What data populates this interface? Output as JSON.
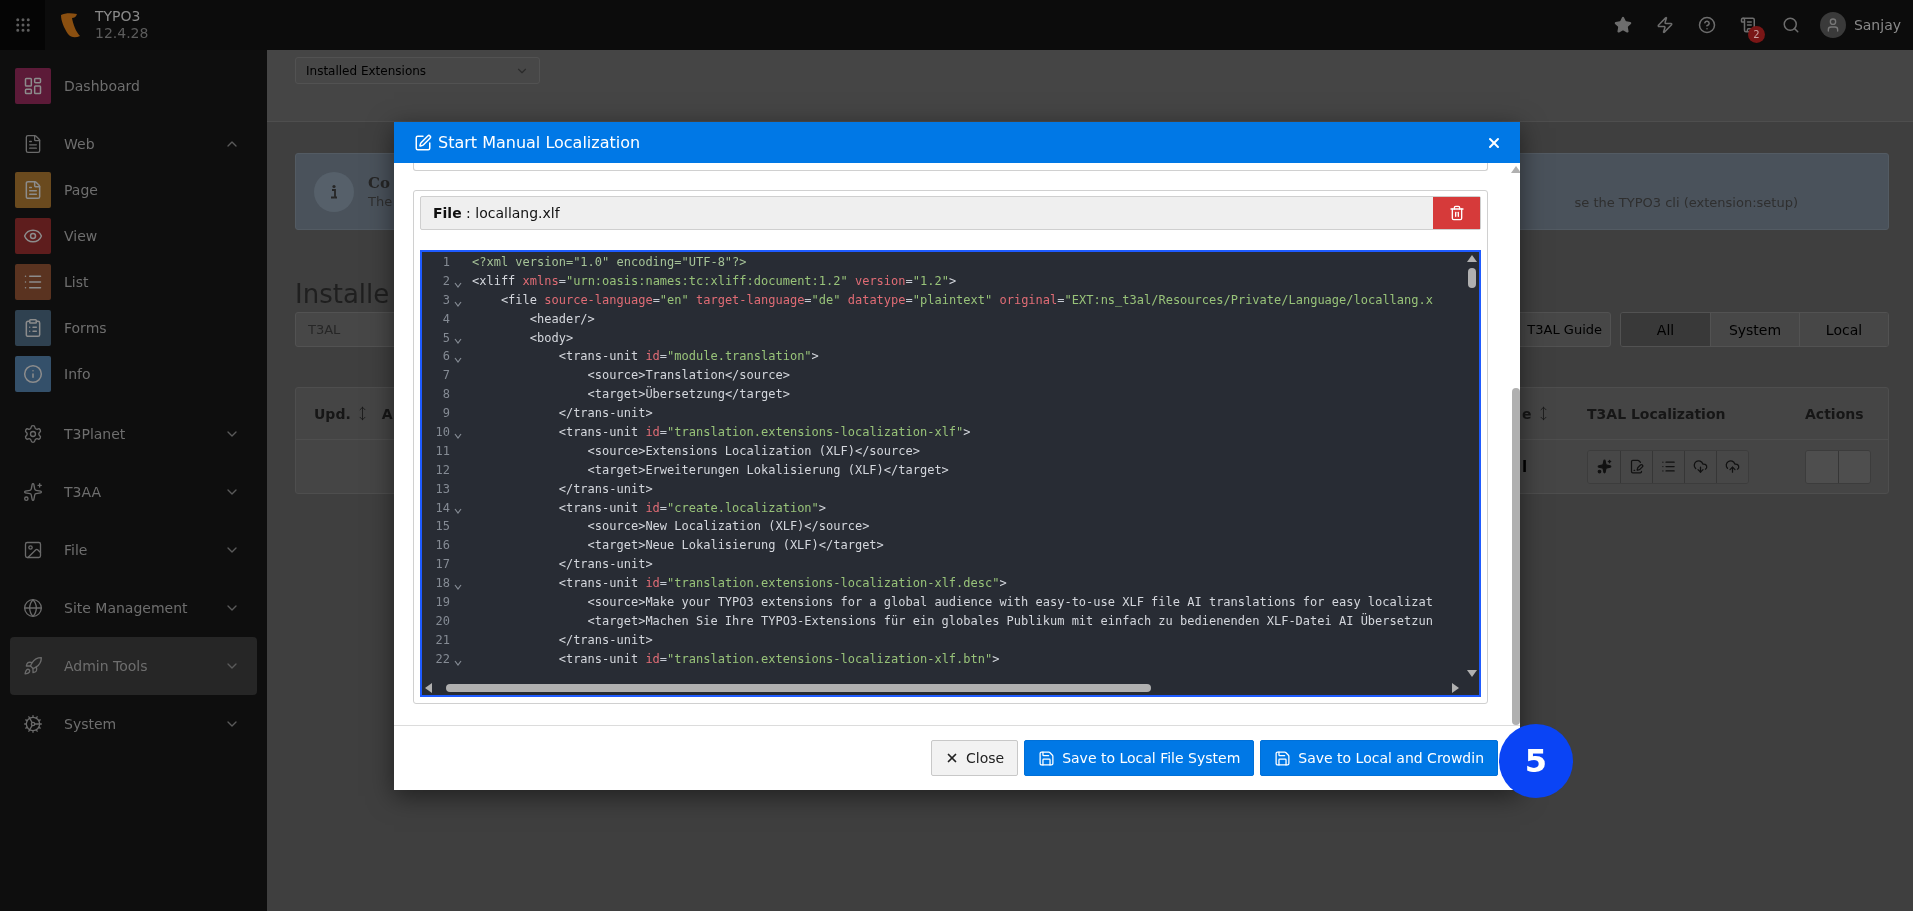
{
  "topbar": {
    "brand": "TYPO3",
    "version": "12.4.28",
    "notification_count": "2",
    "user": "Sanjay"
  },
  "sidebar": {
    "items": [
      {
        "label": "Dashboard",
        "kind": "module",
        "color": "#5c1a38",
        "selected": false
      },
      {
        "label": "Web",
        "kind": "group",
        "expanded": true,
        "selected": false,
        "children": [
          {
            "label": "Page",
            "color": "#6a4a1e",
            "selected": false
          },
          {
            "label": "View",
            "color": "#5e1d1d",
            "selected": false
          },
          {
            "label": "List",
            "color": "#5a3320",
            "selected": false
          },
          {
            "label": "Forms",
            "color": "#2f4150",
            "selected": false
          },
          {
            "label": "Info",
            "color": "#34506a",
            "selected": false
          }
        ]
      },
      {
        "label": "T3Planet",
        "kind": "group",
        "expanded": false,
        "selected": false
      },
      {
        "label": "T3AA",
        "kind": "group",
        "expanded": false,
        "selected": false
      },
      {
        "label": "File",
        "kind": "group",
        "expanded": false,
        "selected": false
      },
      {
        "label": "Site Management",
        "kind": "group",
        "expanded": false,
        "selected": false
      },
      {
        "label": "Admin Tools",
        "kind": "group",
        "expanded": false,
        "selected": true
      },
      {
        "label": "System",
        "kind": "group",
        "expanded": false,
        "selected": false
      }
    ]
  },
  "module_header": {
    "view_select": "Installed Extensions"
  },
  "callout": {
    "title": "Co",
    "text_left": "The",
    "text_right": "se the TYPO3 cli (extension:setup)"
  },
  "heading": "Installe",
  "filter": {
    "search_value": "T3AL",
    "guide_button": "T3AL Guide",
    "views": [
      {
        "label": "All",
        "selected": true
      },
      {
        "label": "System",
        "selected": false
      },
      {
        "label": "Local",
        "selected": false
      }
    ]
  },
  "table": {
    "columns_left": [
      {
        "label": "Upd.",
        "sortable": true
      },
      {
        "label": "A",
        "sortable": false
      }
    ],
    "columns_right": [
      {
        "label": "e",
        "sortable": true
      },
      {
        "label": "T3AL Localization",
        "sortable": false
      },
      {
        "label": "Actions",
        "sortable": false
      }
    ],
    "rows": [
      {
        "cell_fragment": "l"
      }
    ]
  },
  "modal": {
    "title": "Start Manual Localization",
    "file_label": "**File** : locallang.xlf",
    "editor": {
      "lines": [
        {
          "number": "1",
          "fold": false,
          "tokens": [
            {
              "kind": "meta",
              "text": "<?xml version=\"1.0\" encoding=\"UTF-8\"?>"
            }
          ]
        },
        {
          "number": "2",
          "fold": true,
          "tokens": [
            {
              "kind": "tag",
              "text": "<xliff"
            },
            {
              "kind": "attr",
              "text": " xmlns"
            },
            {
              "kind": "punct",
              "text": "="
            },
            {
              "kind": "string",
              "text": "\"urn:oasis:names:tc:xliff:document:1.2\""
            },
            {
              "kind": "attr",
              "text": " version"
            },
            {
              "kind": "punct",
              "text": "="
            },
            {
              "kind": "string",
              "text": "\"1.2\""
            },
            {
              "kind": "tag",
              "text": ">"
            }
          ]
        },
        {
          "number": "3",
          "fold": true,
          "tokens": [
            {
              "kind": "tag",
              "text": "    <file"
            },
            {
              "kind": "attr",
              "text": " source-language"
            },
            {
              "kind": "punct",
              "text": "="
            },
            {
              "kind": "string",
              "text": "\"en\""
            },
            {
              "kind": "attr",
              "text": " target-language"
            },
            {
              "kind": "punct",
              "text": "="
            },
            {
              "kind": "string",
              "text": "\"de\""
            },
            {
              "kind": "attr",
              "text": " datatype"
            },
            {
              "kind": "punct",
              "text": "="
            },
            {
              "kind": "string",
              "text": "\"plaintext\""
            },
            {
              "kind": "attr",
              "text": " original"
            },
            {
              "kind": "punct",
              "text": "="
            },
            {
              "kind": "string",
              "text": "\"EXT:ns_t3al/Resources/Private/Language/locallang.x"
            }
          ]
        },
        {
          "number": "4",
          "fold": false,
          "tokens": [
            {
              "kind": "tag",
              "text": "        <header/>"
            }
          ]
        },
        {
          "number": "5",
          "fold": true,
          "tokens": [
            {
              "kind": "tag",
              "text": "        <body>"
            }
          ]
        },
        {
          "number": "6",
          "fold": true,
          "tokens": [
            {
              "kind": "tag",
              "text": "            <trans-unit"
            },
            {
              "kind": "attr",
              "text": " id"
            },
            {
              "kind": "punct",
              "text": "="
            },
            {
              "kind": "string",
              "text": "\"module.translation\""
            },
            {
              "kind": "tag",
              "text": ">"
            }
          ]
        },
        {
          "number": "7",
          "fold": false,
          "tokens": [
            {
              "kind": "tag",
              "text": "                <source>"
            },
            {
              "kind": "text",
              "text": "Translation"
            },
            {
              "kind": "tag",
              "text": "</source>"
            }
          ]
        },
        {
          "number": "8",
          "fold": false,
          "tokens": [
            {
              "kind": "tag",
              "text": "                <target>"
            },
            {
              "kind": "text",
              "text": "Übersetzung"
            },
            {
              "kind": "tag",
              "text": "</target>"
            }
          ]
        },
        {
          "number": "9",
          "fold": false,
          "tokens": [
            {
              "kind": "tag",
              "text": "            </trans-unit>"
            }
          ]
        },
        {
          "number": "10",
          "fold": true,
          "tokens": [
            {
              "kind": "tag",
              "text": "            <trans-unit"
            },
            {
              "kind": "attr",
              "text": " id"
            },
            {
              "kind": "punct",
              "text": "="
            },
            {
              "kind": "string",
              "text": "\"translation.extensions-localization-xlf\""
            },
            {
              "kind": "tag",
              "text": ">"
            }
          ]
        },
        {
          "number": "11",
          "fold": false,
          "tokens": [
            {
              "kind": "tag",
              "text": "                <source>"
            },
            {
              "kind": "text",
              "text": "Extensions Localization (XLF)"
            },
            {
              "kind": "tag",
              "text": "</source>"
            }
          ]
        },
        {
          "number": "12",
          "fold": false,
          "tokens": [
            {
              "kind": "tag",
              "text": "                <target>"
            },
            {
              "kind": "text",
              "text": "Erweiterungen Lokalisierung (XLF)"
            },
            {
              "kind": "tag",
              "text": "</target>"
            }
          ]
        },
        {
          "number": "13",
          "fold": false,
          "tokens": [
            {
              "kind": "tag",
              "text": "            </trans-unit>"
            }
          ]
        },
        {
          "number": "14",
          "fold": true,
          "tokens": [
            {
              "kind": "tag",
              "text": "            <trans-unit"
            },
            {
              "kind": "attr",
              "text": " id"
            },
            {
              "kind": "punct",
              "text": "="
            },
            {
              "kind": "string",
              "text": "\"create.localization\""
            },
            {
              "kind": "tag",
              "text": ">"
            }
          ]
        },
        {
          "number": "15",
          "fold": false,
          "tokens": [
            {
              "kind": "tag",
              "text": "                <source>"
            },
            {
              "kind": "text",
              "text": "New Localization (XLF)"
            },
            {
              "kind": "tag",
              "text": "</source>"
            }
          ]
        },
        {
          "number": "16",
          "fold": false,
          "tokens": [
            {
              "kind": "tag",
              "text": "                <target>"
            },
            {
              "kind": "text",
              "text": "Neue Lokalisierung (XLF)"
            },
            {
              "kind": "tag",
              "text": "</target>"
            }
          ]
        },
        {
          "number": "17",
          "fold": false,
          "tokens": [
            {
              "kind": "tag",
              "text": "            </trans-unit>"
            }
          ]
        },
        {
          "number": "18",
          "fold": true,
          "tokens": [
            {
              "kind": "tag",
              "text": "            <trans-unit"
            },
            {
              "kind": "attr",
              "text": " id"
            },
            {
              "kind": "punct",
              "text": "="
            },
            {
              "kind": "string",
              "text": "\"translation.extensions-localization-xlf.desc\""
            },
            {
              "kind": "tag",
              "text": ">"
            }
          ]
        },
        {
          "number": "19",
          "fold": false,
          "tokens": [
            {
              "kind": "tag",
              "text": "                <source>"
            },
            {
              "kind": "text",
              "text": "Make your TYPO3 extensions for a global audience with easy-to-use XLF file AI translations for easy localizat"
            }
          ]
        },
        {
          "number": "20",
          "fold": false,
          "tokens": [
            {
              "kind": "tag",
              "text": "                <target>"
            },
            {
              "kind": "text",
              "text": "Machen Sie Ihre TYPO3-Extensions für ein globales Publikum mit einfach zu bedienenden XLF-Datei AI Übersetzun"
            }
          ]
        },
        {
          "number": "21",
          "fold": false,
          "tokens": [
            {
              "kind": "tag",
              "text": "            </trans-unit>"
            }
          ]
        },
        {
          "number": "22",
          "fold": true,
          "tokens": [
            {
              "kind": "tag",
              "text": "            <trans-unit"
            },
            {
              "kind": "attr",
              "text": " id"
            },
            {
              "kind": "punct",
              "text": "="
            },
            {
              "kind": "string",
              "text": "\"translation.extensions-localization-xlf.btn\""
            },
            {
              "kind": "tag",
              "text": ">"
            }
          ]
        }
      ]
    },
    "buttons": [
      {
        "label": "Close",
        "kind": "close"
      },
      {
        "label": "Save to Local File System",
        "kind": "save"
      },
      {
        "label": "Save to Local and Crowdin",
        "kind": "save"
      }
    ]
  },
  "step_badge": "5"
}
